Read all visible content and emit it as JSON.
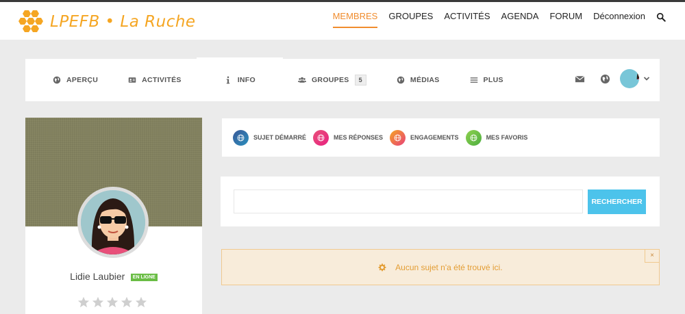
{
  "header": {
    "logo_text": "LPEFB • La Ruche",
    "nav": [
      "MEMBRES",
      "GROUPES",
      "ACTIVITÉS",
      "AGENDA",
      "FORUM",
      "Déconnexion"
    ],
    "active_nav": "MEMBRES",
    "accent_color": "#f08c2d"
  },
  "profile_nav": {
    "tabs": [
      {
        "label": "APERÇU",
        "icon": "globe-icon"
      },
      {
        "label": "ACTIVITÉS",
        "icon": "id-card-icon"
      },
      {
        "label": "INFO",
        "icon": "info-icon"
      },
      {
        "label": "GROUPES",
        "icon": "users-icon",
        "count": "5"
      },
      {
        "label": "MÉDIAS",
        "icon": "globe-icon"
      },
      {
        "label": "PLUS",
        "icon": "menu-icon"
      }
    ],
    "active_tab": "INFO"
  },
  "user": {
    "name": "Lidie Laubier",
    "status": "EN LIGNE",
    "rating_stars": 5,
    "rating_filled": 0
  },
  "forum_filters": [
    {
      "label": "SUJET DÉMARRÉ",
      "color": "#3b5998"
    },
    {
      "label": "MES RÉPONSES",
      "color": "#e83e6c"
    },
    {
      "label": "ENGAGEMENTS",
      "color": "#f06b2d"
    },
    {
      "label": "MES FAVORIS",
      "color": "#6ac43f"
    }
  ],
  "search": {
    "value": "",
    "button_label": "RECHERCHER"
  },
  "notice": {
    "text": "Aucun sujet n'a été trouvé ici.",
    "close": "×"
  }
}
